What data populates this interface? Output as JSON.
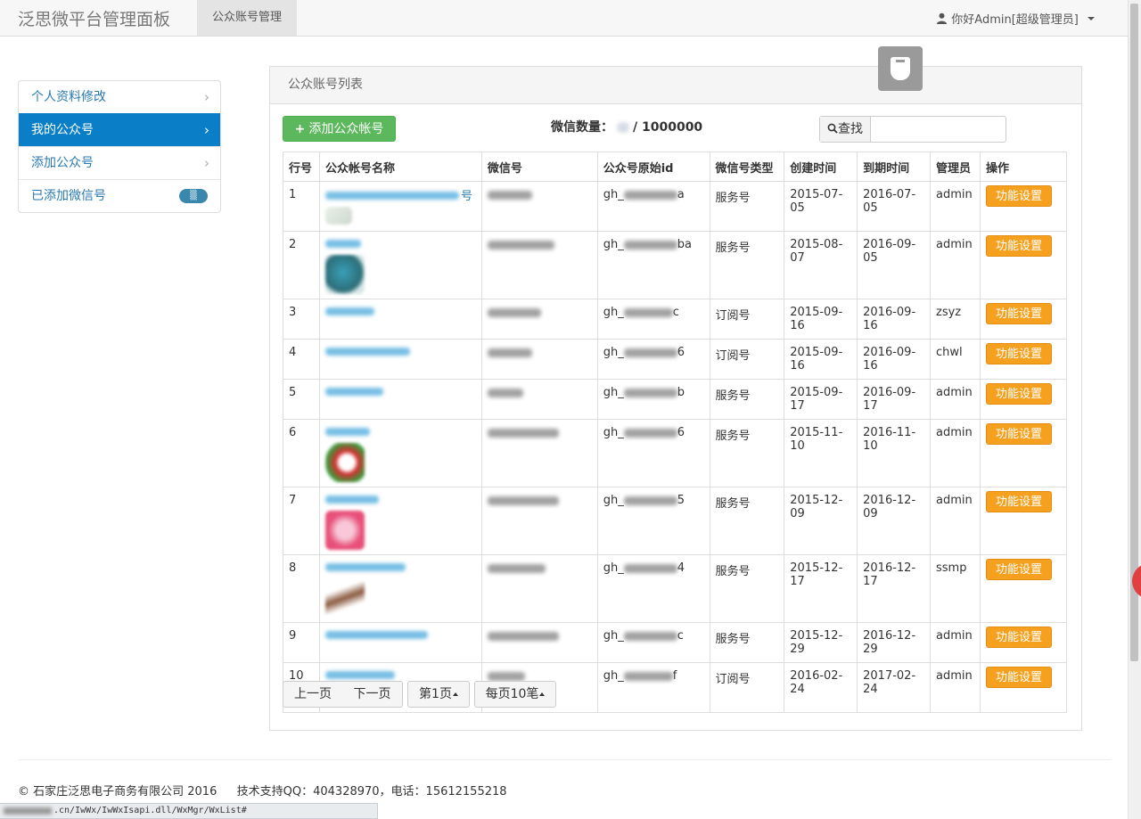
{
  "navbar": {
    "brand": "泛思微平台管理面板",
    "active_tab": "公众账号管理",
    "user_greeting": "你好Admin[超级管理员]"
  },
  "sidebar": {
    "items": [
      {
        "label": "个人资料修改",
        "active": false
      },
      {
        "label": "我的公众号",
        "active": true
      },
      {
        "label": "添加公众号",
        "active": false
      },
      {
        "label": "已添加微信号",
        "active": false
      }
    ]
  },
  "panel": {
    "title": "公众账号列表",
    "add_button": "添加公众帐号",
    "count_label": "微信数量：",
    "count_max": "/ 1000000",
    "search_button": "查找",
    "search_value": ""
  },
  "table": {
    "headers": [
      "行号",
      "公众帐号名称",
      "微信号",
      "公众号原始id",
      "微信号类型",
      "创建时间",
      "到期时间",
      "管理员",
      "操作"
    ],
    "name_suffix_row1": "号",
    "gh_prefix": "gh_",
    "action_label": "功能设置",
    "rows": [
      {
        "no": "1",
        "id_tail": "a",
        "type": "服务号",
        "created": "2015-07-05",
        "expires": "2016-07-05",
        "admin": "admin"
      },
      {
        "no": "2",
        "id_tail": "ba",
        "type": "服务号",
        "created": "2015-08-07",
        "expires": "2016-09-05",
        "admin": "admin"
      },
      {
        "no": "3",
        "id_tail": "c",
        "type": "订阅号",
        "created": "2015-09-16",
        "expires": "2016-09-16",
        "admin": "zsyz"
      },
      {
        "no": "4",
        "id_tail": "6",
        "type": "订阅号",
        "created": "2015-09-16",
        "expires": "2016-09-16",
        "admin": "chwl"
      },
      {
        "no": "5",
        "id_tail": "b",
        "type": "服务号",
        "created": "2015-09-17",
        "expires": "2016-09-17",
        "admin": "admin"
      },
      {
        "no": "6",
        "id_tail": "6",
        "type": "服务号",
        "created": "2015-11-10",
        "expires": "2016-11-10",
        "admin": "admin"
      },
      {
        "no": "7",
        "id_tail": "5",
        "type": "服务号",
        "created": "2015-12-09",
        "expires": "2016-12-09",
        "admin": "admin"
      },
      {
        "no": "8",
        "id_tail": "4",
        "type": "服务号",
        "created": "2015-12-17",
        "expires": "2016-12-17",
        "admin": "ssmp"
      },
      {
        "no": "9",
        "id_tail": "c",
        "type": "服务号",
        "created": "2015-12-29",
        "expires": "2016-12-29",
        "admin": "admin"
      },
      {
        "no": "10",
        "id_tail": "f",
        "type": "订阅号",
        "created": "2016-02-24",
        "expires": "2017-02-24",
        "admin": "admin"
      }
    ]
  },
  "pagination": {
    "prev": "上一页",
    "next": "下一页",
    "page": "第1页",
    "per_page": "每页10笔"
  },
  "footer": {
    "copyright": "© 石家庄泛思电子商务有限公司 2016",
    "support": "技术支持QQ：404328970，电话：15612155218"
  },
  "status_bar": {
    "url": ".cn/IwWx/IwWxIsapi.dll/WxMgr/WxList#"
  }
}
